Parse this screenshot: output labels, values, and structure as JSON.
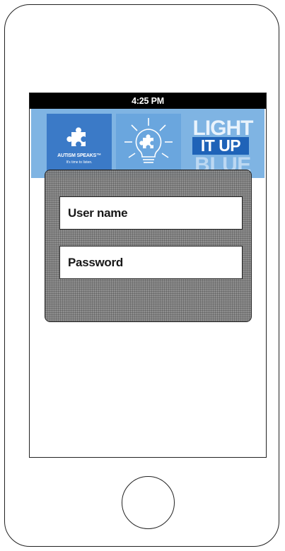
{
  "status_bar": {
    "time": "4:25 PM"
  },
  "banner": {
    "autism_title": "AUTISM SPEAKS™",
    "autism_tagline": "It's time to listen.",
    "light_line1": "LIGHT",
    "light_line2": "IT UP",
    "light_line3": "BLUE",
    "icons": [
      "puzzle-piece-icon",
      "lightbulb-icon"
    ],
    "colors": {
      "brand_blue": "#3b7ac7",
      "light_blue": "#7fb4e3",
      "deep_blue": "#1f63b8"
    }
  },
  "login": {
    "username_placeholder": "User name",
    "password_placeholder": "Password"
  }
}
